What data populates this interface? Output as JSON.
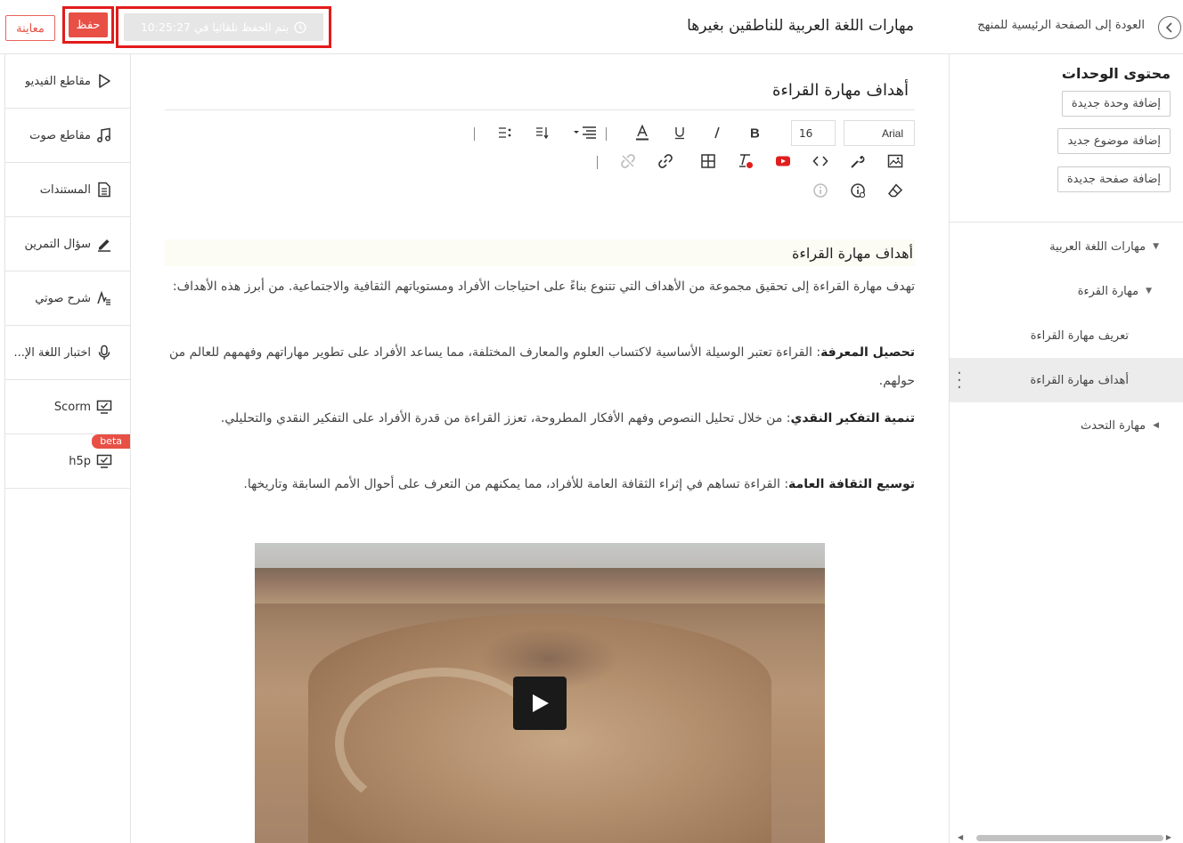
{
  "header": {
    "back_label": "العودة إلى الصفحة الرئيسية للمنهج",
    "page_title": "مهارات اللغة العربية للناطقين بغيرها",
    "autosave_text": "يتم الحفظ تلقائيا في 10:25:27",
    "save_label": "حفظ",
    "preview_label": "معاينة"
  },
  "tools": [
    {
      "label": "مقاطع الفيديو",
      "icon": "play-icon"
    },
    {
      "label": "مقاطع صوت",
      "icon": "music-note-icon"
    },
    {
      "label": "المستندات",
      "icon": "document-icon"
    },
    {
      "label": "سؤال التمرين",
      "icon": "pencil-icon"
    },
    {
      "label": "شرح صوتي",
      "icon": "voice-explanation-icon"
    },
    {
      "label": "اختبار اللغة الإ...",
      "icon": "microphone-icon"
    },
    {
      "label": "Scorm",
      "icon": "monitor-icon"
    },
    {
      "label": "h5p",
      "icon": "monitor-icon",
      "badge": "beta"
    }
  ],
  "units": {
    "title": "محتوى الوحدات",
    "add_unit": "إضافة وحدة جديدة",
    "add_topic": "إضافة موضوع جديد",
    "add_page": "إضافة صفحة جديدة",
    "tree": [
      {
        "label": "مهارات اللغة العربية",
        "arrow": "▼"
      },
      {
        "label": "مهارة القرءة",
        "arrow": "▼"
      },
      {
        "label": "تعريف مهارة القراءة",
        "arrow": ""
      },
      {
        "label": "أهداف مهارة القراءة",
        "arrow": "",
        "active": true
      },
      {
        "label": "مهارة التحدث",
        "arrow": "◀"
      }
    ]
  },
  "editor": {
    "doc_title": "أهداف مهارة القراءة",
    "font_family": "Arial",
    "font_size": "16",
    "section_heading": "أهداف مهارة القراءة",
    "intro": "تهدف مهارة القراءة إلى تحقيق مجموعة من الأهداف التي تتنوع بناءً على احتياجات الأفراد ومستوياتهم الثقافية والاجتماعية. من أبرز هذه الأهداف:",
    "goals": [
      {
        "term": "تحصيل المعرفة",
        "text": " القراءة تعتبر الوسيلة الأساسية لاكتساب العلوم والمعارف المختلفة، مما يساعد الأفراد على تطوير مهاراتهم وفهمهم للعالم من حولهم."
      },
      {
        "term": "تنمية التفكير النقدي",
        "text": " من خلال تحليل النصوص وفهم الأفكار المطروحة، تعزز القراءة من قدرة الأفراد على التفكير النقدي والتحليلي."
      },
      {
        "term": "توسيع الثقافة العامة",
        "text": " القراءة تساهم في إثراء الثقافة العامة للأفراد، مما يمكنهم من التعرف على أحوال الأمم السابقة وتاريخها."
      }
    ],
    "video_icon": "play-icon"
  },
  "colors": {
    "accent": "#e85045",
    "highlight_border": "#e31b1b",
    "autosave_bg": "#e6e6e6",
    "active_tree_bg": "#ececec"
  }
}
